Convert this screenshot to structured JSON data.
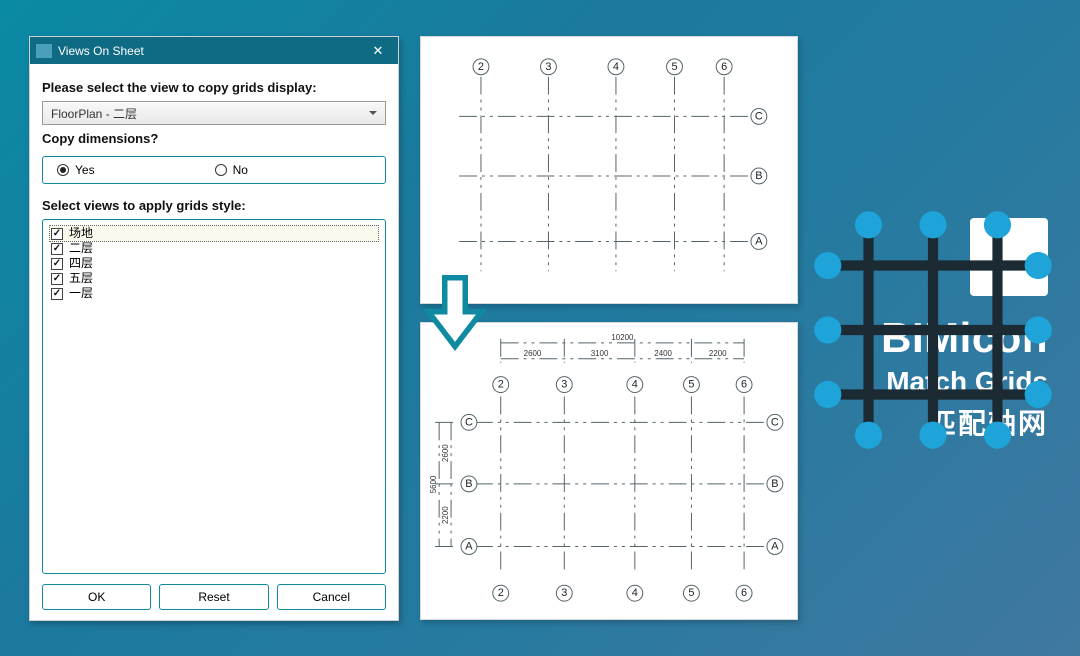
{
  "dialog": {
    "title": "Views On Sheet",
    "prompt_copy": "Please select the view to copy grids display:",
    "combo_value": "FloorPlan - 二层",
    "copy_q": "Copy dimensions?",
    "radio_yes": "Yes",
    "radio_no": "No",
    "select_views_label": "Select views to apply grids style:",
    "views": [
      {
        "label": "场地"
      },
      {
        "label": "二层"
      },
      {
        "label": "四层"
      },
      {
        "label": "五层"
      },
      {
        "label": "一层"
      }
    ],
    "ok": "OK",
    "reset": "Reset",
    "cancel": "Cancel"
  },
  "grids_top": {
    "cols": [
      "2",
      "3",
      "4",
      "5",
      "6"
    ],
    "rows": [
      "C",
      "B",
      "A"
    ]
  },
  "grids_bot": {
    "cols": [
      "2",
      "3",
      "4",
      "5",
      "6"
    ],
    "rows": [
      "C",
      "B",
      "A"
    ],
    "dim_total": "10200",
    "dim_h": [
      "2600",
      "3100",
      "2400",
      "2200"
    ],
    "dim_v_total": "5600",
    "dim_v": [
      "2600",
      "2200"
    ]
  },
  "branding": {
    "a": "BIMicon",
    "b": "Match Grids",
    "c": "匹配轴网"
  }
}
